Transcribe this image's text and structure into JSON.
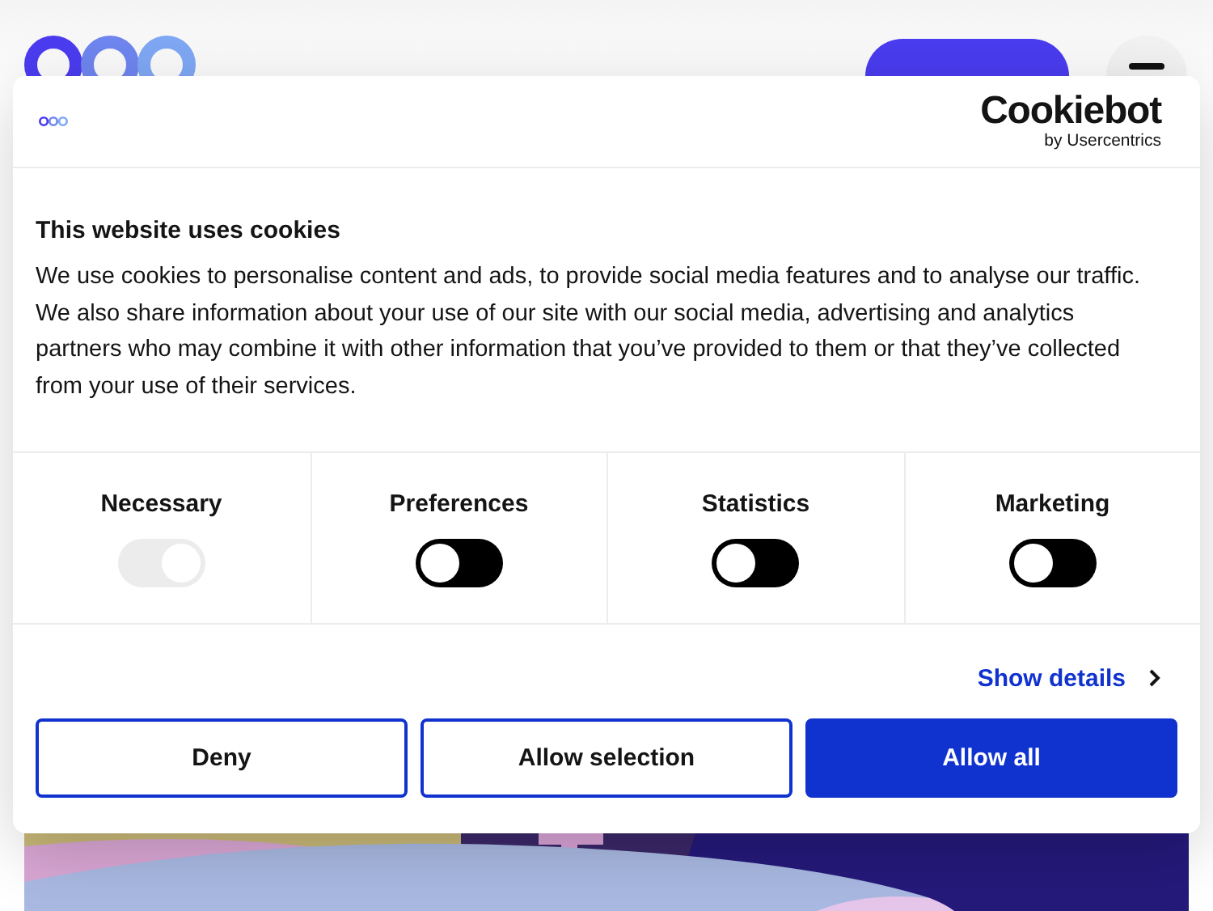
{
  "dialog": {
    "brand": {
      "name": "Cookiebot",
      "tagline": "by Usercentrics"
    },
    "title": "This website uses cookies",
    "body": "We use cookies to personalise content and ads, to provide social media features and to analyse our traffic. We also share information about your use of our site with our social media, advertising and analytics partners who may combine it with other information that you’ve provided to them or that they’ve collected from your use of their services.",
    "categories": [
      {
        "label": "Necessary",
        "on": true,
        "disabled": true
      },
      {
        "label": "Preferences",
        "on": false,
        "disabled": false
      },
      {
        "label": "Statistics",
        "on": false,
        "disabled": false
      },
      {
        "label": "Marketing",
        "on": false,
        "disabled": false
      }
    ],
    "details_link": "Show details",
    "buttons": [
      {
        "label": "Deny",
        "kind": "outline"
      },
      {
        "label": "Allow selection",
        "kind": "outline"
      },
      {
        "label": "Allow all",
        "kind": "filled"
      }
    ]
  }
}
